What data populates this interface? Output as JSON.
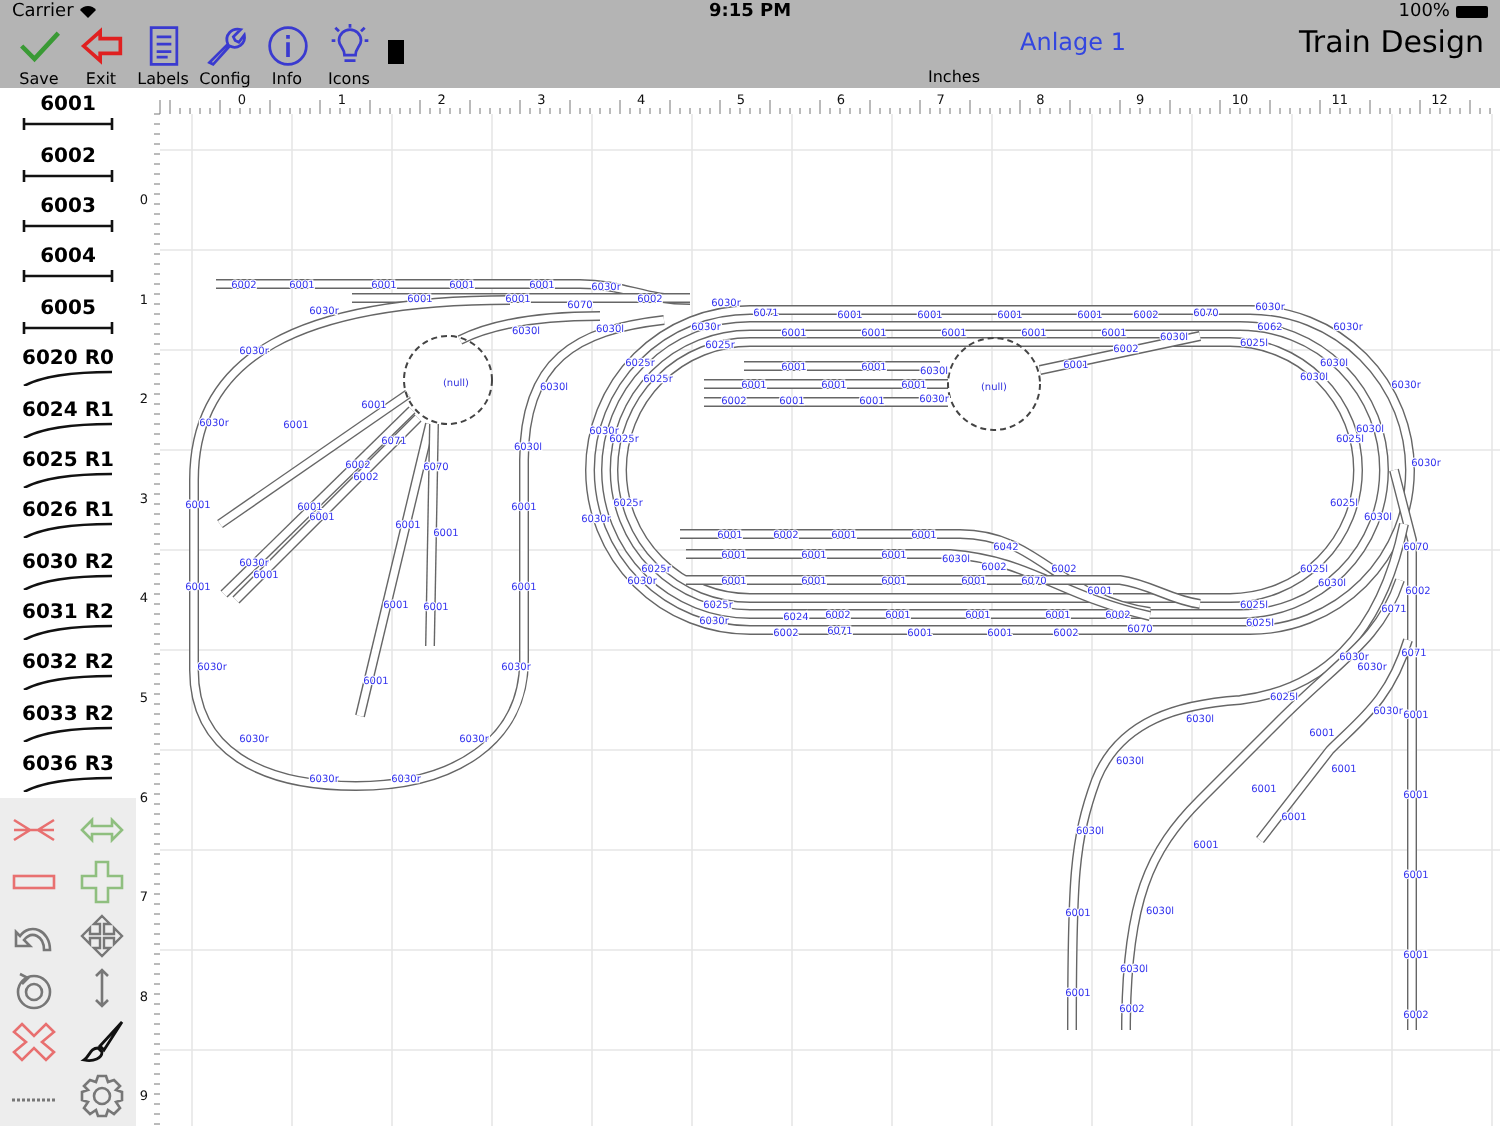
{
  "status_bar": {
    "carrier": "Carrier",
    "time": "9:15 PM",
    "battery": "100%"
  },
  "toolbar": {
    "buttons": [
      {
        "label": "Save",
        "kind": "save"
      },
      {
        "label": "Exit",
        "kind": "exit"
      },
      {
        "label": "Labels",
        "kind": "labels"
      },
      {
        "label": "Config",
        "kind": "config"
      },
      {
        "label": "Info",
        "kind": "info"
      },
      {
        "label": "Icons",
        "kind": "icons"
      },
      {
        "kind": "swatch"
      }
    ],
    "layout_name": "Anlage 1",
    "app_title": "Train Design",
    "ruler_unit": "Inches"
  },
  "palette": [
    {
      "label": "6001",
      "kind": "straight"
    },
    {
      "label": "6002",
      "kind": "straight"
    },
    {
      "label": "6003",
      "kind": "straight"
    },
    {
      "label": "6004",
      "kind": "straight"
    },
    {
      "label": "6005",
      "kind": "straight"
    },
    {
      "label": "6020 R0",
      "kind": "curve"
    },
    {
      "label": "6024 R1",
      "kind": "curve"
    },
    {
      "label": "6025 R1",
      "kind": "curve"
    },
    {
      "label": "6026 R1",
      "kind": "curve"
    },
    {
      "label": "6030 R2",
      "kind": "curve"
    },
    {
      "label": "6031 R2",
      "kind": "curve"
    },
    {
      "label": "6032 R2",
      "kind": "curve"
    },
    {
      "label": "6033 R2",
      "kind": "curve"
    },
    {
      "label": "6036 R3",
      "kind": "curve"
    }
  ],
  "tools": [
    {
      "kind": "split"
    },
    {
      "kind": "stretch"
    },
    {
      "kind": "remove-piece"
    },
    {
      "kind": "add-piece"
    },
    {
      "kind": "rotate"
    },
    {
      "kind": "move"
    },
    {
      "kind": "rotate-circle"
    },
    {
      "kind": "vertical"
    },
    {
      "kind": "delete"
    },
    {
      "kind": "paint"
    },
    {
      "kind": "measure"
    },
    {
      "kind": "settings"
    }
  ],
  "ruler": {
    "x_ticks": [
      "0",
      "1",
      "2",
      "3",
      "4",
      "5",
      "6",
      "7",
      "8",
      "9",
      "10",
      "11",
      "12"
    ],
    "y_ticks": [
      "0",
      "1",
      "2",
      "3",
      "4",
      "5",
      "6",
      "7",
      "8",
      "9"
    ]
  },
  "turntable_labels": [
    "(null)",
    "(null)"
  ],
  "track_labels": [
    "6002",
    "6001",
    "6001",
    "6001",
    "6001",
    "6030r",
    "6001",
    "6001",
    "6070",
    "6030r",
    "6030r",
    "6030r",
    "6001",
    "6001",
    "6030r",
    "6030r",
    "6030r",
    "6030r",
    "6030r",
    "6030r",
    "6030l",
    "6030l",
    "6030l",
    "6001",
    "6001",
    "6001",
    "6001",
    "6071",
    "6002",
    "6002",
    "6070",
    "6001",
    "6001",
    "6001",
    "6001",
    "6030r",
    "6001",
    "6001",
    "6001",
    "6001",
    "6002",
    "6030r",
    "6071",
    "6001",
    "6001",
    "6001",
    "6001",
    "6002",
    "6030l",
    "6030r",
    "6001",
    "6001",
    "6001",
    "6001",
    "6001",
    "6025r",
    "6025r",
    "6025r",
    "6001",
    "6001",
    "6030l",
    "6001",
    "6001",
    "6001",
    "6002",
    "6001",
    "6001",
    "6030r",
    "6001",
    "6030r",
    "6025r",
    "6030r",
    "6025r",
    "6025r",
    "6030r",
    "6025r",
    "6030r",
    "6001",
    "6002",
    "6001",
    "6001",
    "6042",
    "6001",
    "6001",
    "6001",
    "6030l",
    "6002",
    "6002",
    "6001",
    "6001",
    "6001",
    "6001",
    "6070",
    "6001",
    "6024",
    "6002",
    "6001",
    "6001",
    "6001",
    "6002",
    "6002",
    "6071",
    "6001",
    "6001",
    "6002",
    "6070",
    "6070",
    "6030r",
    "6062",
    "6030r",
    "6025l",
    "6030l",
    "6030l",
    "6030r",
    "6002",
    "6030l",
    "6030l",
    "6025l",
    "6030r",
    "6025l",
    "6030l",
    "6025l",
    "6030l",
    "6025l",
    "6025l",
    "6070",
    "6002",
    "6071",
    "6071",
    "6030r",
    "6030r",
    "6025l",
    "6030l",
    "6030r",
    "6001",
    "6001",
    "6030l",
    "6001",
    "6001",
    "6001",
    "6001",
    "6030l",
    "6001",
    "6001",
    "6002",
    "6001",
    "6030l",
    "6030l",
    "6002",
    "6001",
    "6001"
  ]
}
